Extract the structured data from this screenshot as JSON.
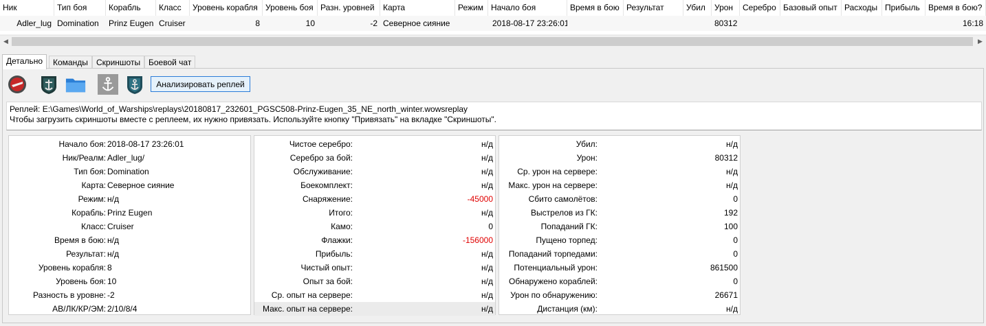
{
  "grid": {
    "columns": [
      "Ник",
      "Тип боя",
      "Корабль",
      "Класс",
      "Уровень корабля",
      "Уровень боя",
      "Разн. уровней",
      "Карта",
      "Режим",
      "Начало боя",
      "Время в бою",
      "Результат",
      "Убил",
      "Урон",
      "Серебро",
      "Базовый опыт",
      "Расходы",
      "Прибыль",
      "Время в бою?"
    ],
    "row": [
      "Adler_lug",
      "Domination",
      "Prinz Eugen",
      "Cruiser",
      "8",
      "10",
      "-2",
      "Северное сияние",
      "",
      "2018-08-17 23:26:01",
      "",
      "",
      "",
      "80312",
      "",
      "",
      "",
      "",
      "16:18"
    ]
  },
  "tabs": [
    "Детально",
    "Команды",
    "Скриншоты",
    "Боевой чат"
  ],
  "toolbar": {
    "icons": [
      "wargaming-icon",
      "wows-emblem-icon",
      "folder-icon",
      "anchor-icon",
      "wows-anchor-icon"
    ],
    "analyze_label": "Анализировать реплей"
  },
  "info": {
    "line1": "Реплей: E:\\Games\\World_of_Warships\\replays\\20180817_232601_PGSC508-Prinz-Eugen_35_NE_north_winter.wowsreplay",
    "line2": "Чтобы загрузить скриншоты вместе с реплеем, их нужно привязать. Используйте кнопку \"Привязать\" на вкладке \"Скриншоты\"."
  },
  "details": {
    "col1": [
      {
        "k": "Начало боя:",
        "v": "2018-08-17 23:26:01"
      },
      {
        "k": "Ник/Реалм:",
        "v": "Adler_lug/"
      },
      {
        "k": "Тип боя:",
        "v": "Domination"
      },
      {
        "k": "Карта:",
        "v": "Северное сияние"
      },
      {
        "k": "Режим:",
        "v": "н/д"
      },
      {
        "k": "Корабль:",
        "v": "Prinz Eugen"
      },
      {
        "k": "Класс:",
        "v": "Cruiser"
      },
      {
        "k": "Время в бою:",
        "v": "н/д"
      },
      {
        "k": "Результат:",
        "v": "н/д"
      },
      {
        "k": "Уровень корабля:",
        "v": "8"
      },
      {
        "k": "Уровень боя:",
        "v": "10"
      },
      {
        "k": "Разность в уровне:",
        "v": "-2"
      },
      {
        "k": "АВ/ЛК/КР/ЭМ:",
        "v": "2/10/8/4"
      }
    ],
    "col2": [
      {
        "k": "Чистое серебро:",
        "v": "н/д"
      },
      {
        "k": "Серебро за бой:",
        "v": "н/д"
      },
      {
        "k": "Обслуживание:",
        "v": "н/д"
      },
      {
        "k": "Боекомплект:",
        "v": "н/д"
      },
      {
        "k": "Снаряжение:",
        "v": "-45000",
        "neg": true
      },
      {
        "k": "Итого:",
        "v": "н/д"
      },
      {
        "k": "Камо:",
        "v": "0"
      },
      {
        "k": "Флажки:",
        "v": "-156000",
        "neg": true
      },
      {
        "k": "Прибыль:",
        "v": "н/д"
      },
      {
        "k": "Чистый опыт:",
        "v": "н/д"
      },
      {
        "k": "Опыт за бой:",
        "v": "н/д"
      },
      {
        "k": "Ср. опыт на сервере:",
        "v": "н/д"
      },
      {
        "k": "Макс. опыт на сервере:",
        "v": "н/д",
        "hl": true
      }
    ],
    "col3": [
      {
        "k": "Убил:",
        "v": "н/д"
      },
      {
        "k": "Урон:",
        "v": "80312"
      },
      {
        "k": "Ср. урон на сервере:",
        "v": "н/д"
      },
      {
        "k": "Макс. урон на сервере:",
        "v": "н/д"
      },
      {
        "k": "Сбито самолётов:",
        "v": "0"
      },
      {
        "k": "Выстрелов из ГК:",
        "v": "192"
      },
      {
        "k": "Попаданий ГК:",
        "v": "100"
      },
      {
        "k": "Пущено торпед:",
        "v": "0"
      },
      {
        "k": "Попаданий торпедами:",
        "v": "0"
      },
      {
        "k": "Потенциальный урон:",
        "v": "861500"
      },
      {
        "k": "Обнаружено кораблей:",
        "v": "0"
      },
      {
        "k": "Урон по обнаружению:",
        "v": "26671"
      },
      {
        "k": "Дистанция (км):",
        "v": "н/д"
      }
    ]
  }
}
